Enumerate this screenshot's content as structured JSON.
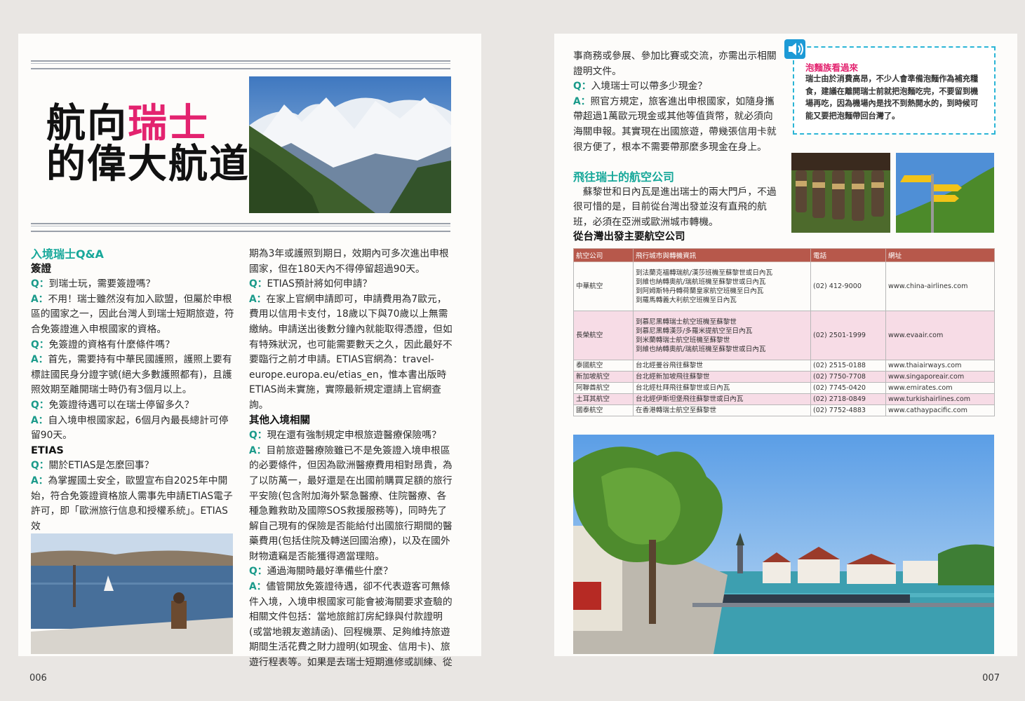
{
  "title": {
    "line1_a": "航向",
    "line1_b": "瑞士",
    "line2": "的偉大航道"
  },
  "left": {
    "section_qa": "入境瑞士Q&A",
    "h_visa": "簽證",
    "q1": "到瑞士玩，需要簽證嗎？",
    "a1": "不用！瑞士雖然沒有加入歐盟，但屬於申根區的國家之一，因此台灣人到瑞士短期旅遊，符合免簽證進入申根國家的資格。",
    "q2": "免簽證的資格有什麼條件嗎？",
    "a2": "首先，需要持有中華民國護照，護照上要有標註國民身分證字號(絕大多數護照都有)，且護照效期至離開瑞士時仍有3個月以上。",
    "q3": "免簽證待遇可以在瑞士停留多久？",
    "a3": "自入境申根國家起，6個月內最長總計可停留90天。",
    "h_etias": "ETIAS",
    "q4": "關於ETIAS是怎麼回事？",
    "a4": "為掌握國土安全，歐盟宣布自2025年中開始，符合免簽證資格旅人需事先申請ETIAS電子許可，即「歐洲旅行信息和授權系統」。ETIAS效",
    "col2_cont": "期為3年或護照到期日，效期內可多次進出申根國家，但在180天內不得停留超過90天。",
    "q5": "ETIAS預計將如何申請？",
    "a5": "在家上官網申請即可，申請費用為7歐元，費用以信用卡支付，18歲以下與70歲以上無需繳納。申請送出後數分鐘內就能取得憑證，但如有特殊狀況，也可能需要數天之久，因此最好不要臨行之前才申請。ETIAS官網為：travel-europe.europa.eu/etias_en，惟本書出版時ETIAS尚未實施，實際最新規定還請上官網查詢。",
    "h_other": "其他入境相關",
    "q6": "現在還有強制規定申根旅遊醫療保險嗎？",
    "a6": "目前旅遊醫療險雖已不是免簽證入境申根區的必要條件，但因為歐洲醫療費用相對昂貴，為了以防萬一，最好還是在出國前購買足額的旅行平安險(包含附加海外緊急醫療、住院醫療、各種急難救助及國際SOS救援服務等)，同時先了解自己現有的保險是否能給付出國旅行期間的醫藥費用(包括住院及轉送回國治療)，以及在國外財物遺竊是否能獲得適當理賠。",
    "q7": "通過海關時最好準備些什麼？",
    "a7": "儘管開放免簽證待遇，卻不代表遊客可無條件入境，入境申根國家可能會被海關要求查驗的相關文件包括：當地旅館訂房紀錄與付款證明(或當地親友邀請函)、回程機票、足夠維持旅遊期間生活花費之財力證明(如現金、信用卡)、旅遊行程表等。如果是去瑞士短期進修或訓練、從",
    "page": "006"
  },
  "right": {
    "cont": "事商務或參展、參加比賽或交流，亦需出示相關證明文件。",
    "q8": "入境瑞士可以帶多少現金？",
    "a8": "照官方規定，旅客進出申根國家，如隨身攜帶超過1萬歐元現金或其他等值貨幣，就必須向海關申報。其實現在出國旅遊，帶幾張信用卡就很方便了，根本不需要帶那麼多現金在身上。",
    "h_airline": "飛往瑞士的航空公司",
    "airline_text": "蘇黎世和日內瓦是進出瑞士的兩大門戶，不過很可惜的是，目前從台灣出發並沒有直飛的航班，必須在亞洲或歐洲城市轉機。",
    "h_table": "從台灣出發主要航空公司",
    "tip_title": "泡麵族看過來",
    "tip_text": "瑞士由於消費高昂，不少人會準備泡麵作為補充糧食，建議在離開瑞士前就把泡麵吃完，不要留到機場再吃，因為機場內是找不到熱開水的，到時候可能又要把泡麵帶回台灣了。",
    "page": "007"
  },
  "qa_marks": {
    "q": "Q：",
    "a": "A："
  },
  "table": {
    "headers": [
      "航空公司",
      "飛行城市與轉機資訊",
      "電話",
      "網址"
    ],
    "rows": [
      {
        "name": "中華航空",
        "info": [
          "到法蘭克福轉瑞航/漢莎班機至蘇黎世或日內瓦",
          "到維也納轉奧航/瑞航班機至蘇黎世或日內瓦",
          "到阿姆斯特丹轉荷蘭皇家航空班機至日內瓦",
          "到羅馬轉義大利航空班機至日內瓦"
        ],
        "phone": "(02) 412-9000",
        "url": "www.china-airlines.com"
      },
      {
        "name": "長榮航空",
        "info": [
          "到慕尼黑轉瑞士航空班機至蘇黎世",
          "到慕尼黑轉漢莎/多羅米提航空至日內瓦",
          "到米蘭轉瑞士航空班機至蘇黎世",
          "到維也納轉奧航/瑞航班機至蘇黎世或日內瓦"
        ],
        "phone": "(02) 2501-1999",
        "url": "www.evaair.com"
      },
      {
        "name": "泰國航空",
        "info": [
          "台北經曼谷飛往蘇黎世"
        ],
        "phone": "(02) 2515-0188",
        "url": "www.thaiairways.com"
      },
      {
        "name": "新加坡航空",
        "info": [
          "台北經新加坡飛往蘇黎世"
        ],
        "phone": "(02) 7750-7708",
        "url": "www.singaporeair.com"
      },
      {
        "name": "阿聯酋航空",
        "info": [
          "台北經杜拜飛往蘇黎世或日內瓦"
        ],
        "phone": "(02) 7745-0420",
        "url": "www.emirates.com"
      },
      {
        "name": "土耳其航空",
        "info": [
          "台北經伊斯坦堡飛往蘇黎世或日內瓦"
        ],
        "phone": "(02) 2718-0849",
        "url": "www.turkishairlines.com"
      },
      {
        "name": "國泰航空",
        "info": [
          "在香港轉瑞士航空至蘇黎世"
        ],
        "phone": "(02) 7752-4883",
        "url": "www.cathaypacific.com"
      }
    ]
  },
  "colors": {
    "accent_pink": "#e3236f",
    "teal": "#17a89a",
    "table_header": "#b7584b",
    "table_pink_row": "#f7dce6",
    "tip_border": "#2bb5d6"
  }
}
